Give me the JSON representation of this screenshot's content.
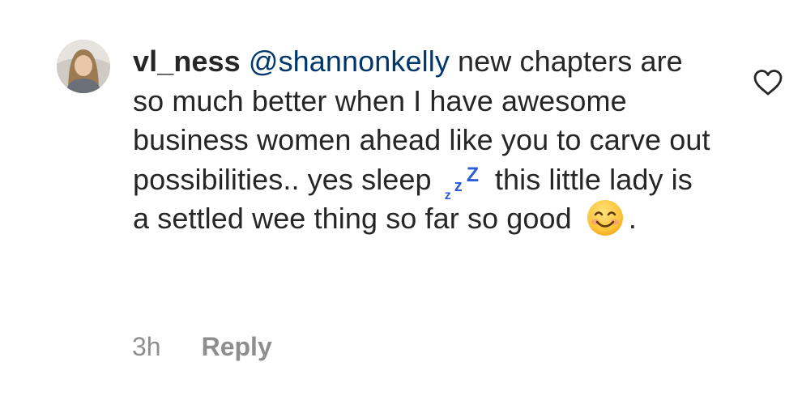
{
  "comment": {
    "username": "vl_ness",
    "mention": "@shannonkelly",
    "text_before_zzz": " new chapters are so much better when I have awesome business women ahead like you to carve out possibilities.. yes sleep ",
    "zzz_emoji": "💤",
    "text_after_zzz": " this little lady is a settled wee thing so far so good ",
    "smiley_emoji": "😊",
    "text_end": ".",
    "timestamp": "3h",
    "reply_label": "Reply"
  },
  "icons": {
    "avatar": "avatar",
    "like": "heart-outline-icon",
    "zzz": "zzz-emoji",
    "smiley": "smiling-face-emoji"
  },
  "colors": {
    "username": "#262626",
    "mention": "#00376b",
    "meta": "#8e8e8e",
    "zzz": "#2d5dd7",
    "heart_stroke": "#262626"
  }
}
